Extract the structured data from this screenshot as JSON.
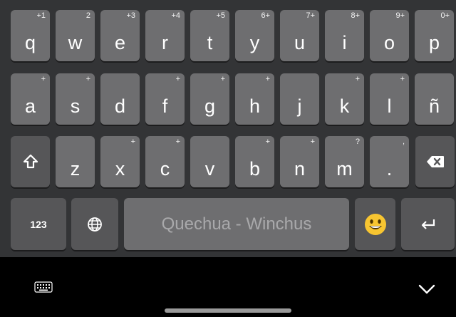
{
  "keyboard": {
    "row1": [
      {
        "key": "q",
        "hint": "+1"
      },
      {
        "key": "w",
        "hint": "2"
      },
      {
        "key": "e",
        "hint": "+3"
      },
      {
        "key": "r",
        "hint": "+4"
      },
      {
        "key": "t",
        "hint": "+5"
      },
      {
        "key": "y",
        "hint": "6+"
      },
      {
        "key": "u",
        "hint": "7+"
      },
      {
        "key": "i",
        "hint": "8+"
      },
      {
        "key": "o",
        "hint": "9+"
      },
      {
        "key": "p",
        "hint": "0+"
      }
    ],
    "row2": [
      {
        "key": "a",
        "hint": "+"
      },
      {
        "key": "s",
        "hint": "+"
      },
      {
        "key": "d",
        "hint": ""
      },
      {
        "key": "f",
        "hint": "+"
      },
      {
        "key": "g",
        "hint": "+"
      },
      {
        "key": "h",
        "hint": "+"
      },
      {
        "key": "j",
        "hint": ""
      },
      {
        "key": "k",
        "hint": "+"
      },
      {
        "key": "l",
        "hint": "+"
      },
      {
        "key": "ñ",
        "hint": ""
      }
    ],
    "row3": [
      {
        "key": "z",
        "hint": ""
      },
      {
        "key": "x",
        "hint": "+"
      },
      {
        "key": "c",
        "hint": "+"
      },
      {
        "key": "v",
        "hint": ""
      },
      {
        "key": "b",
        "hint": "+"
      },
      {
        "key": "n",
        "hint": "+"
      },
      {
        "key": "m",
        "hint": "?"
      },
      {
        "key": ".",
        "hint": ","
      }
    ],
    "numbers_label": "123",
    "space_label": "Quechua - Winchus",
    "shift_icon": "shift-icon",
    "backspace_icon": "backspace-icon",
    "globe_icon": "globe-icon",
    "emoji_icon": "emoji-icon",
    "enter_icon": "enter-icon"
  },
  "nav": {
    "keyboard_switch_icon": "keyboard-icon",
    "hide_keyboard_icon": "chevron-down-icon"
  },
  "colors": {
    "background": "#333436",
    "key": "#6e6e70",
    "function_key": "#565658",
    "nav_bar": "#000000"
  }
}
